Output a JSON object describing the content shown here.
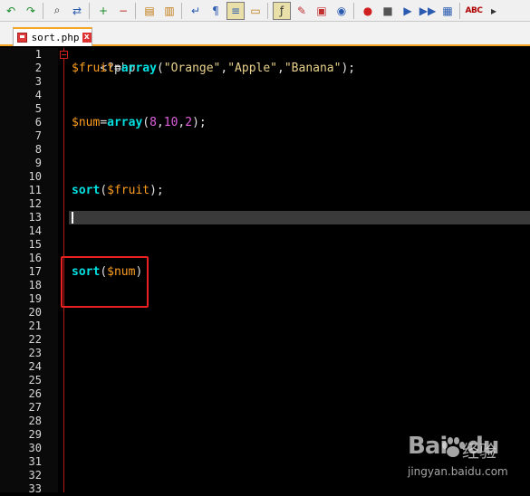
{
  "toolbar": {
    "buttons": [
      {
        "name": "undo-icon",
        "glyph": "↶",
        "color": "#1a8a2a"
      },
      {
        "name": "redo-icon",
        "glyph": "↷",
        "color": "#1a8a2a"
      },
      {
        "name": "find-icon",
        "glyph": "⌕",
        "color": "#333333"
      },
      {
        "name": "replace-icon",
        "glyph": "⇄",
        "color": "#2a5bb0"
      },
      {
        "name": "zoom-in-icon",
        "glyph": "+",
        "color": "#1a8a2a"
      },
      {
        "name": "zoom-out-icon",
        "glyph": "−",
        "color": "#c03030"
      },
      {
        "name": "sync-vertical-icon",
        "glyph": "▤",
        "color": "#c07a10"
      },
      {
        "name": "sync-horizontal-icon",
        "glyph": "▥",
        "color": "#c07a10"
      },
      {
        "name": "word-wrap-icon",
        "glyph": "↵",
        "color": "#2a5bb0"
      },
      {
        "name": "show-all-chars-icon",
        "glyph": "¶",
        "color": "#2a5bb0"
      },
      {
        "name": "indent-guide-icon",
        "glyph": "≡",
        "color": "#2a5bb0"
      },
      {
        "name": "folder-icon",
        "glyph": "▭",
        "color": "#c07a10"
      },
      {
        "name": "function-list-icon",
        "glyph": "ƒ",
        "color": "#333333"
      },
      {
        "name": "doc-map-icon",
        "glyph": "✎",
        "color": "#c03030"
      },
      {
        "name": "panel-icon",
        "glyph": "▣",
        "color": "#c03030"
      },
      {
        "name": "monitor-icon",
        "glyph": "◉",
        "color": "#2a5bb0"
      },
      {
        "name": "record-macro-icon",
        "glyph": "●",
        "color": "#d02020"
      },
      {
        "name": "stop-macro-icon",
        "glyph": "■",
        "color": "#555555"
      },
      {
        "name": "play-macro-icon",
        "glyph": "▶",
        "color": "#2a5bb0"
      },
      {
        "name": "run-macro-multiple-icon",
        "glyph": "▶▶",
        "color": "#2a5bb0"
      },
      {
        "name": "save-macro-icon",
        "glyph": "▦",
        "color": "#2a5bb0"
      },
      {
        "name": "spell-check-icon",
        "glyph": "ABC",
        "color": "#b00000"
      },
      {
        "name": "console-icon",
        "glyph": "▸",
        "color": "#333333"
      }
    ]
  },
  "tab": {
    "label": "sort.php",
    "close": "x"
  },
  "editor": {
    "line_numbers": [
      "1",
      "2",
      "3",
      "4",
      "5",
      "6",
      "7",
      "8",
      "9",
      "10",
      "11",
      "12",
      "13",
      "14",
      "15",
      "16",
      "17",
      "18",
      "19",
      "20",
      "21",
      "22",
      "23",
      "24",
      "25",
      "26",
      "27",
      "28",
      "29",
      "30",
      "31",
      "32",
      "33"
    ],
    "current_line": 13,
    "lines": {
      "l1": {
        "tag": "<?php"
      },
      "l2": {
        "var": "$fruit",
        "eq": "=",
        "fn": "array",
        "open": "(",
        "s1": "\"Orange\"",
        "c1": ",",
        "s2": "\"Apple\"",
        "c2": ",",
        "s3": "\"Banana\"",
        "close": ");"
      },
      "l6": {
        "var": "$num",
        "eq": "=",
        "fn": "array",
        "open": "(",
        "n1": "8",
        "c1": ",",
        "n2": "10",
        "c2": ",",
        "n3": "2",
        "close": ");"
      },
      "l11": {
        "fn": "sort",
        "open": "(",
        "var": "$fruit",
        "close": ");"
      },
      "l17": {
        "fn": "sort",
        "open": "(",
        "var": "$num",
        "close": ")"
      }
    }
  },
  "watermark": {
    "brand": "Bai",
    "brand2": "du",
    "sub": "经验",
    "url": "jingyan.baidu.com"
  },
  "colors": {
    "highlight_box": "#e82020",
    "keyword": "#00e0e0",
    "variable": "#ff9e1f",
    "string": "#e8d18a",
    "number": "#e060e0"
  }
}
